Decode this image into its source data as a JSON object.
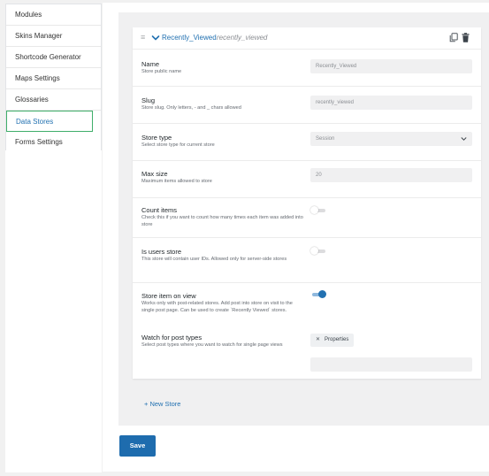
{
  "sidebar": {
    "items": [
      {
        "label": "Modules"
      },
      {
        "label": "Skins Manager"
      },
      {
        "label": "Shortcode Generator"
      },
      {
        "label": "Maps Settings"
      },
      {
        "label": "Glossaries"
      },
      {
        "label": "Data Stores",
        "active": true
      },
      {
        "label": "Forms Settings"
      }
    ]
  },
  "store": {
    "title": "Recently_Viewed",
    "slug": "recently_viewed",
    "fields": {
      "name": {
        "label": "Name",
        "desc": "Store public name",
        "value": "Recently_Viewed"
      },
      "slug": {
        "label": "Slug",
        "desc": "Store slug. Only letters, - and _ chars allowed",
        "value": "recently_viewed"
      },
      "type": {
        "label": "Store type",
        "desc": "Select store type for current store",
        "value": "Session"
      },
      "max_size": {
        "label": "Max size",
        "desc": "Maximum items allowed to store",
        "value": "20"
      },
      "count_items": {
        "label": "Count items",
        "desc": "Check this if you want to count how many times each item was added into store",
        "enabled": false
      },
      "users_store": {
        "label": "Is users store",
        "desc": "This store will contain user IDs. Allowed only for server-side stores",
        "enabled": false
      },
      "on_view": {
        "label": "Store item on view",
        "desc": "Works only with post-related stores. Add post into store on visit to the single post page. Can be used to create `Recently Viewed` stores.",
        "enabled": true
      },
      "post_types": {
        "label": "Watch for post types",
        "desc": "Select post types where you want to watch for single page views",
        "chips": [
          "Properties"
        ]
      }
    }
  },
  "actions": {
    "new_store": "+ New Store",
    "save": "Save"
  },
  "icons": {
    "drag": "drag-handle-icon",
    "chevron": "chevron-down-icon",
    "copy": "copy-icon",
    "trash": "trash-icon",
    "remove": "close-icon"
  },
  "colors": {
    "accent": "#2271b1",
    "active_border": "#3fae6a",
    "save_button": "#1e6cae"
  }
}
